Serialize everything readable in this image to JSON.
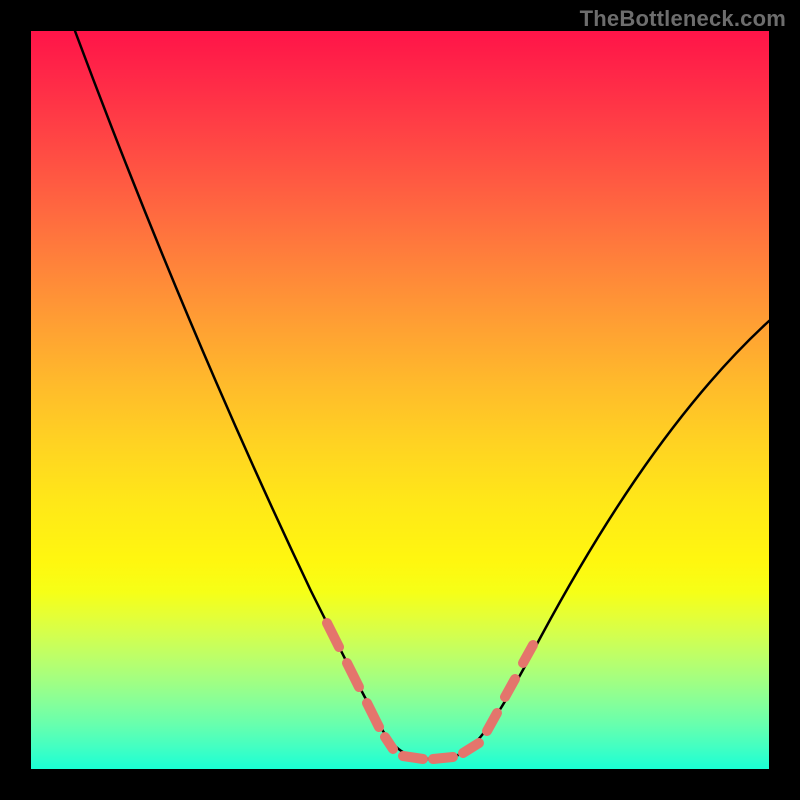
{
  "watermark": "TheBottleneck.com",
  "colors": {
    "background": "#000000",
    "gradient_top": "#ff1449",
    "gradient_mid": "#fff70f",
    "gradient_bottom": "#1affd5",
    "curve": "#000000",
    "dashes": "#e4756c"
  },
  "chart_data": {
    "type": "line",
    "title": "",
    "xlabel": "",
    "ylabel": "",
    "xlim": [
      0,
      100
    ],
    "ylim": [
      0,
      100
    ],
    "series": [
      {
        "name": "bottleneck-curve",
        "x": [
          6,
          10,
          15,
          20,
          25,
          30,
          35,
          40,
          45,
          48,
          50,
          52,
          54,
          56,
          58,
          60,
          62,
          65,
          70,
          75,
          80,
          85,
          90,
          95,
          100
        ],
        "y": [
          100,
          92,
          82,
          72,
          62,
          50,
          38,
          26,
          14,
          8,
          5,
          3,
          2,
          1.5,
          1.5,
          2,
          3,
          6,
          13,
          21,
          29,
          37,
          45,
          53,
          61
        ]
      }
    ],
    "highlight_dashes": {
      "color": "#e4756c",
      "left_x_range": [
        40,
        49
      ],
      "bottom_x_range": [
        49,
        60
      ],
      "right_x_range": [
        60,
        68
      ]
    }
  }
}
